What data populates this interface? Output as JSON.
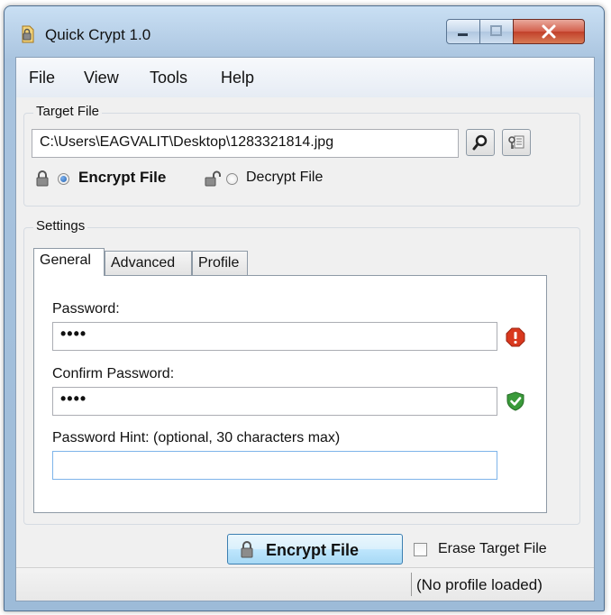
{
  "window": {
    "title": "Quick Crypt 1.0"
  },
  "menu": {
    "items": [
      "File",
      "View",
      "Tools",
      "Help"
    ]
  },
  "target": {
    "group_label": "Target File",
    "path": "C:\\Users\\EAGVALIT\\Desktop\\1283321814.jpg",
    "mode_encrypt": "Encrypt File",
    "mode_decrypt": "Decrypt File",
    "selected_mode": "encrypt"
  },
  "settings": {
    "group_label": "Settings",
    "tabs": [
      "General",
      "Advanced",
      "Profile"
    ],
    "active_tab": "General",
    "password_label": "Password:",
    "password_value": "••••",
    "password_status": "error",
    "confirm_label": "Confirm Password:",
    "confirm_value": "••••",
    "confirm_status": "ok",
    "hint_label": "Password Hint: (optional, 30 characters max)",
    "hint_value": ""
  },
  "actions": {
    "encrypt_button": "Encrypt File",
    "erase_label": "Erase Target File",
    "erase_checked": false
  },
  "status": {
    "text": "(No profile loaded)"
  },
  "colors": {
    "error": "#d9381e",
    "ok": "#3a9a3a",
    "accent": "#3c7fb1"
  }
}
